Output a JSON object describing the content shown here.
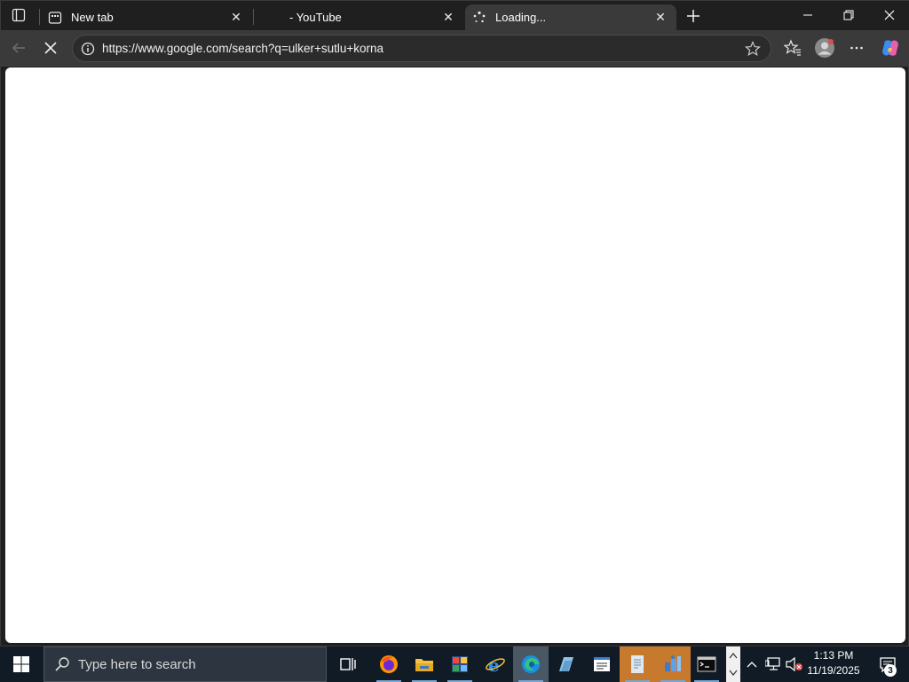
{
  "browser": {
    "tabs": [
      {
        "title": "New tab",
        "favicon": "newtab-icon",
        "active": false
      },
      {
        "title": "- YouTube",
        "favicon": "",
        "active": false
      },
      {
        "title": "Loading...",
        "favicon": "loading-spinner-icon",
        "active": true
      }
    ],
    "url": "https://www.google.com/search?q=ulker+sutlu+korna",
    "colors": {
      "chrome_bg": "#1f1f1f",
      "toolbar_bg": "#3a3a3a",
      "content_bg": "#ffffff"
    }
  },
  "taskbar": {
    "search_placeholder": "Type here to search",
    "pinned": [
      "task-view-icon",
      "firefox-icon",
      "file-explorer-icon",
      "photos-icon",
      "internet-explorer-icon",
      "edge-icon",
      "app-icon",
      "notepad-icon",
      "document-icon",
      "network-app-icon",
      "terminal-icon"
    ],
    "time": "1:13 PM",
    "date": "11/19/2025",
    "notification_count": "3",
    "colors": {
      "taskbar_bg": "#101b25",
      "highlight": "#c77a2e"
    }
  }
}
